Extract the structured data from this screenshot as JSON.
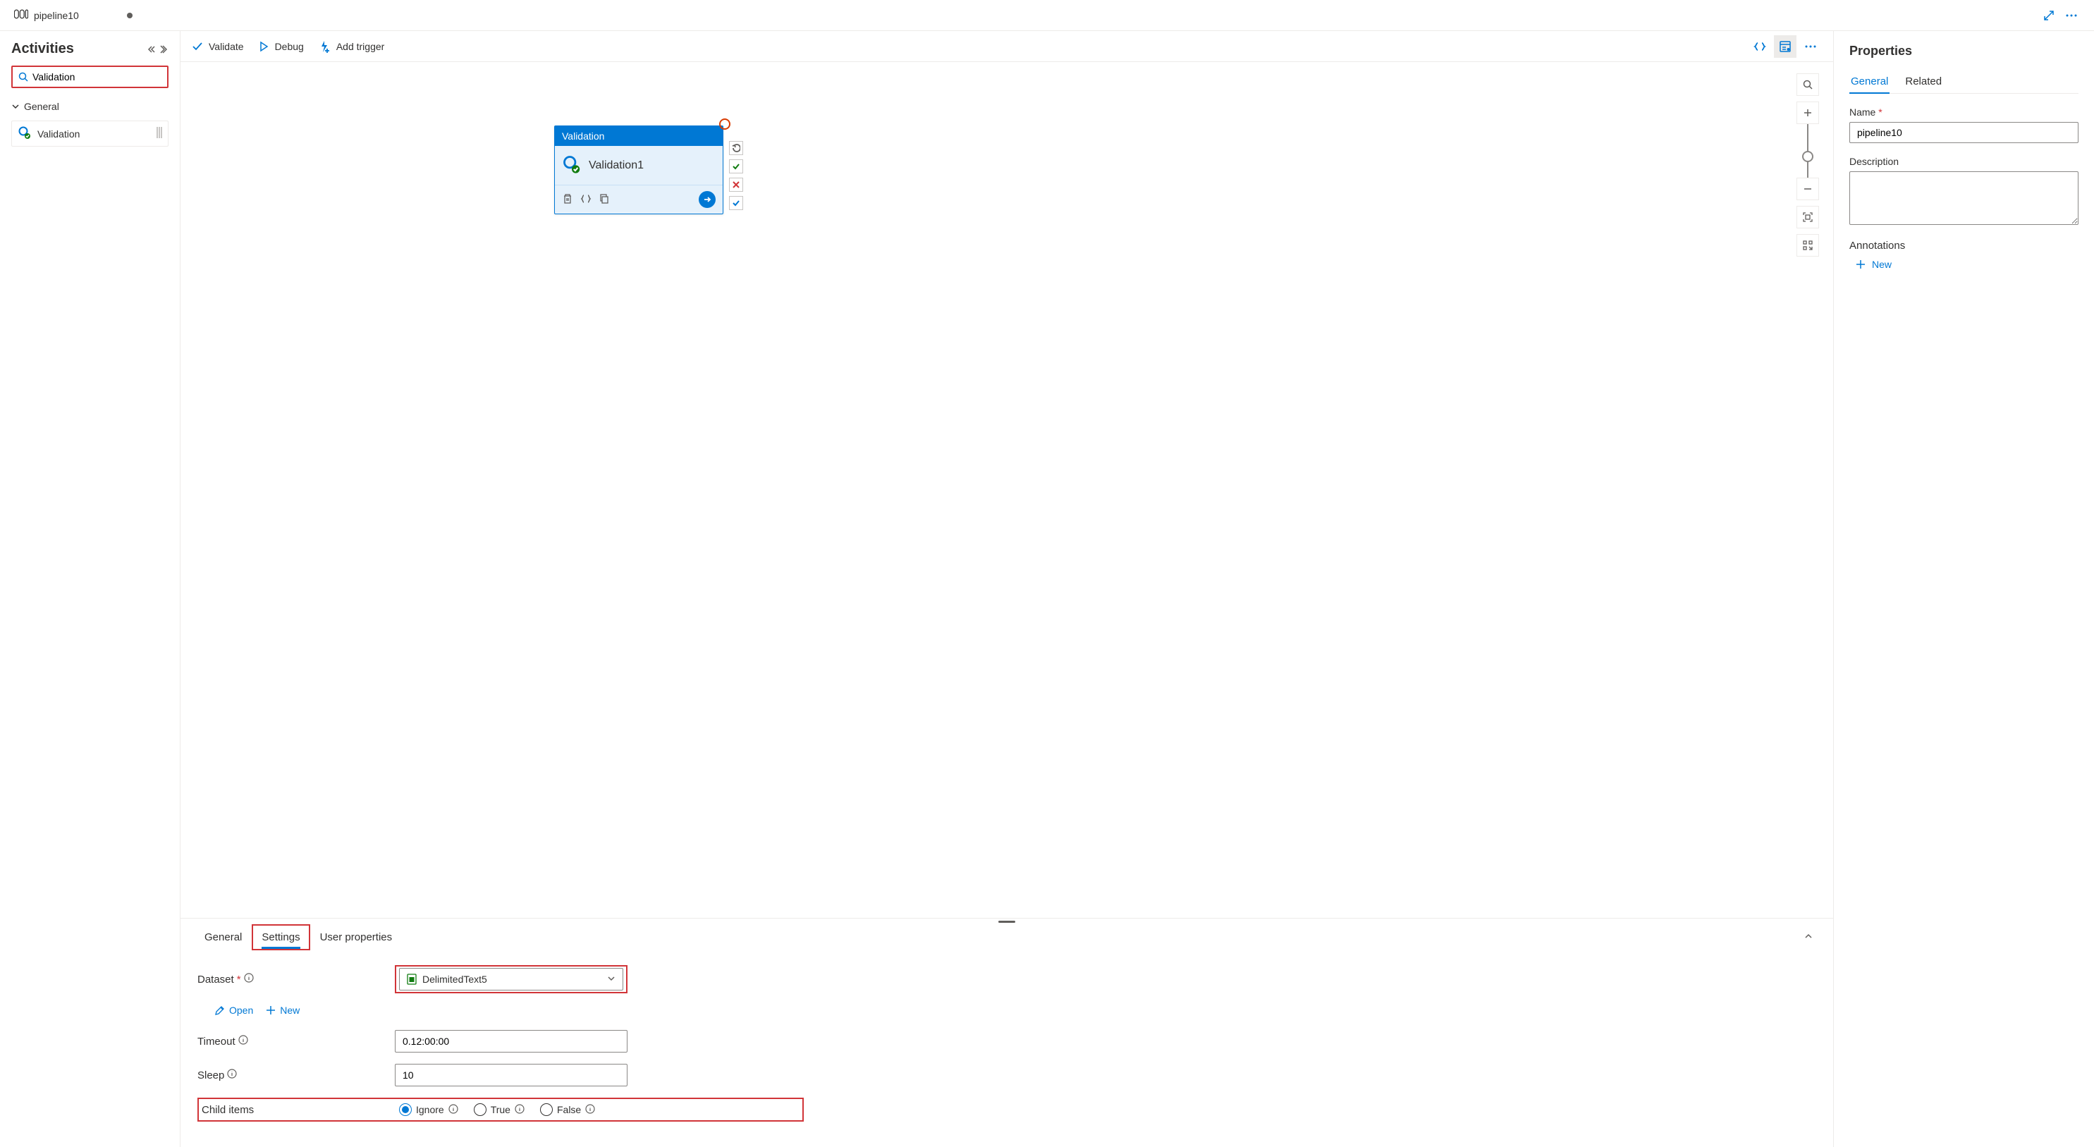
{
  "tab": {
    "title": "pipeline10"
  },
  "sidebar": {
    "title": "Activities",
    "search_value": "Validation",
    "category": "General",
    "activity": "Validation"
  },
  "toolbar": {
    "validate": "Validate",
    "debug": "Debug",
    "add_trigger": "Add trigger"
  },
  "node": {
    "type_label": "Validation",
    "name": "Validation1"
  },
  "bottom": {
    "tabs": {
      "general": "General",
      "settings": "Settings",
      "user_properties": "User properties"
    },
    "dataset_label": "Dataset",
    "dataset_value": "DelimitedText5",
    "open": "Open",
    "new": "New",
    "timeout_label": "Timeout",
    "timeout_value": "0.12:00:00",
    "sleep_label": "Sleep",
    "sleep_value": "10",
    "child_items_label": "Child items",
    "radio": {
      "ignore": "Ignore",
      "true": "True",
      "false": "False"
    }
  },
  "properties": {
    "title": "Properties",
    "tabs": {
      "general": "General",
      "related": "Related"
    },
    "name_label": "Name",
    "name_value": "pipeline10",
    "description_label": "Description",
    "description_value": "",
    "annotations_label": "Annotations",
    "new": "New"
  }
}
